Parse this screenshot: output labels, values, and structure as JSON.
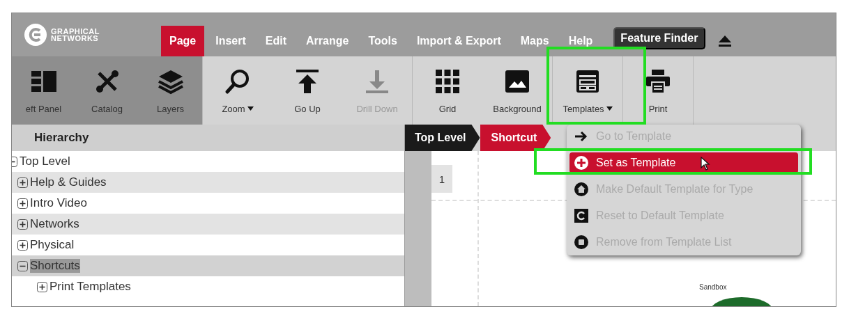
{
  "logo": {
    "line_1": "GRAPHICAL",
    "line_2": "NETWORKS"
  },
  "menu_tabs": [
    {
      "label": "Page",
      "selected": true
    },
    {
      "label": "Insert",
      "selected": false
    },
    {
      "label": "Edit",
      "selected": false
    },
    {
      "label": "Arrange",
      "selected": false
    },
    {
      "label": "Tools",
      "selected": false
    },
    {
      "label": "Import & Export",
      "selected": false
    },
    {
      "label": "Maps",
      "selected": false
    },
    {
      "label": "Help",
      "selected": false
    }
  ],
  "feature_finder": "Feature Finder",
  "toolbar": [
    {
      "kind": "panel",
      "items": [
        {
          "label": "eft Panel",
          "disabled": false,
          "dropdown": false
        },
        {
          "label": "Catalog",
          "disabled": false,
          "dropdown": false
        },
        {
          "label": "Layers",
          "disabled": false,
          "dropdown": false
        }
      ]
    },
    {
      "kind": "plain",
      "items": [
        {
          "label": "Zoom",
          "disabled": false,
          "dropdown": true
        },
        {
          "label": "Go Up",
          "disabled": false,
          "dropdown": false
        },
        {
          "label": "Drill Down",
          "disabled": true,
          "dropdown": false
        }
      ]
    },
    {
      "kind": "plain",
      "items": [
        {
          "label": "Grid",
          "disabled": false,
          "dropdown": false
        },
        {
          "label": "Background",
          "disabled": false,
          "dropdown": false
        }
      ]
    },
    {
      "kind": "plain",
      "items": [
        {
          "label": "Templates",
          "disabled": false,
          "dropdown": true
        }
      ]
    },
    {
      "kind": "plain",
      "items": [
        {
          "label": "Print",
          "disabled": false,
          "dropdown": false
        }
      ]
    }
  ],
  "hierarchy": {
    "title": "Hierarchy",
    "tree": [
      {
        "label": "Top Level",
        "expanded": true,
        "selected": false,
        "children": [
          {
            "label": "Help & Guides",
            "expanded": false,
            "selected": false
          },
          {
            "label": "Intro Video",
            "expanded": false,
            "selected": false
          },
          {
            "label": "Networks",
            "expanded": false,
            "selected": false
          },
          {
            "label": "Physical",
            "expanded": false,
            "selected": false
          },
          {
            "label": "Shortcuts",
            "expanded": true,
            "selected": true,
            "children": [
              {
                "label": "Print Templates",
                "expanded": false,
                "selected": false
              }
            ]
          }
        ]
      }
    ]
  },
  "breadcrumb": [
    {
      "label": "Top Level",
      "current": false
    },
    {
      "label": "Shortcut",
      "current": true
    }
  ],
  "template_menu": [
    {
      "label": "Go to Template",
      "disabled": true,
      "selected": false
    },
    {
      "label": "Set as Template",
      "disabled": false,
      "selected": true
    },
    {
      "label": "Make Default Template for Type",
      "disabled": true,
      "selected": false
    },
    {
      "label": "Reset to Default Template",
      "disabled": true,
      "selected": false
    },
    {
      "label": "Remove from Template List",
      "disabled": true,
      "selected": false
    }
  ],
  "canvas": {
    "page_number": "1",
    "shape_label": "Sandbox"
  }
}
